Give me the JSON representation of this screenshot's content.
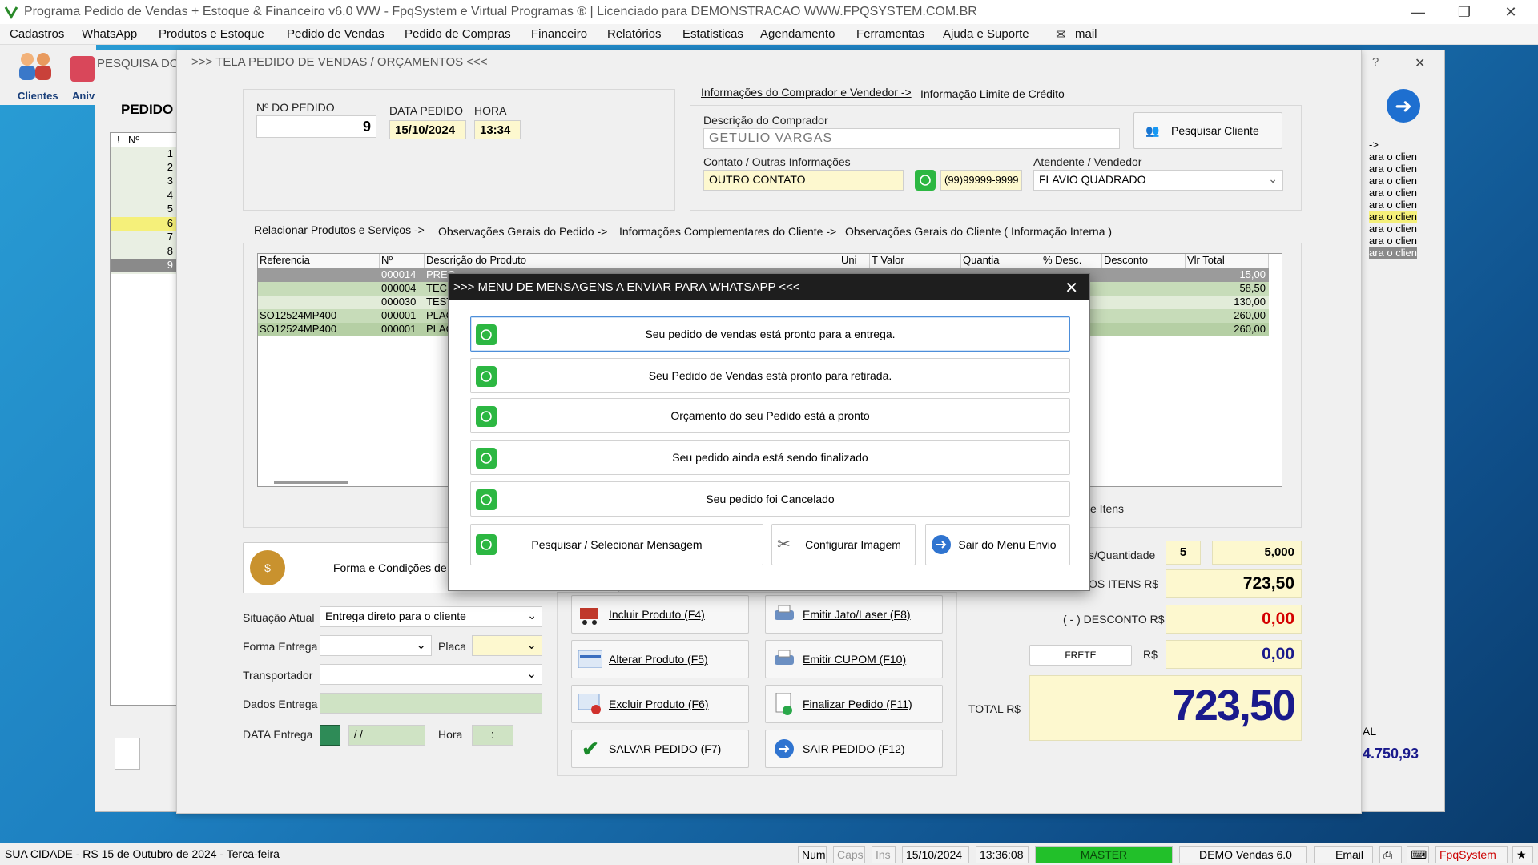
{
  "window": {
    "title": "Programa Pedido de Vendas + Estoque & Financeiro v6.0 WW - FpqSystem e Virtual Programas ® | Licenciado para  DEMONSTRACAO WWW.FPQSYSTEM.COM.BR",
    "minimize": "—",
    "maximize": "❐",
    "close": "✕"
  },
  "menu": [
    "Cadastros",
    "WhatsApp",
    "Produtos e Estoque",
    "Pedido de Vendas",
    "Pedido de Compras",
    "Financeiro",
    "Relatórios",
    "Estatisticas",
    "Agendamento",
    "Ferramentas",
    "Ajuda e Suporte",
    "mail"
  ],
  "toolbar": {
    "clientes": "Clientes",
    "aniv": "Aniv"
  },
  "bg_window": {
    "title": "PESQUISA DOS",
    "heading": "PEDIDO D",
    "list_header": [
      "!",
      "Nº"
    ],
    "list_rows": [
      "1",
      "2",
      "3",
      "4",
      "5",
      "6",
      "7",
      "8",
      "9"
    ],
    "right_items": [
      "->",
      "ara o clien",
      "ara o clien",
      "ara o clien",
      "ara o clien",
      "ara o clien",
      "ara o clien",
      "ara o clien",
      "ara o clien",
      "ara o clien"
    ],
    "total_label": "AL",
    "total_value": "4.750,93"
  },
  "main": {
    "title": ">>>  TELA PEDIDO DE VENDAS / ORÇAMENTOS  <<<",
    "help": "?",
    "close": "✕",
    "pedido_label": "Nº DO PEDIDO",
    "pedido_value": "9",
    "data_label": "DATA PEDIDO",
    "data_value": "15/10/2024",
    "hora_label": "HORA",
    "hora_value": "13:34",
    "tab_comprador": "Informações do Comprador e Vendedor ->",
    "tab_limite": "Informação Limite de Crédito",
    "comprador_label": "Descrição do Comprador",
    "comprador_value": "GETULIO VARGAS",
    "pesquisar_cliente": "Pesquisar Cliente",
    "contato_label": "Contato / Outras Informações",
    "contato_value": "OUTRO CONTATO",
    "telefone_value": "(99)99999-9999",
    "atendente_label": "Atendente / Vendedor",
    "atendente_value": "FLAVIO QUADRADO",
    "tabs": [
      "Relacionar Produtos e Serviços ->",
      "Observações Gerais do Pedido ->",
      "Informações Complementares do Cliente ->",
      "Observações Gerais do Cliente ( Informação Interna )"
    ],
    "grid_headers": [
      "Referencia",
      "Nº",
      "Descrição do Produto",
      "Uni",
      "T Valor",
      "Quantia",
      "% Desc.",
      "Desconto",
      "Vlr Total"
    ],
    "grid_rows": [
      {
        "ref": "",
        "num": "000014",
        "desc": "PREC",
        "total": "15,00"
      },
      {
        "ref": "",
        "num": "000004",
        "desc": "TECL",
        "total": "58,50"
      },
      {
        "ref": "",
        "num": "000030",
        "desc": "TEST",
        "total": "130,00"
      },
      {
        "ref": "SO12524MP400",
        "num": "000001",
        "desc": "PLAC",
        "total": "260,00"
      },
      {
        "ref": "SO12524MP400",
        "num": "000001",
        "desc": "PLAC",
        "total": "260,00"
      }
    ],
    "itens_label": "e Itens",
    "forma_pagamento": "Forma e Condições de Pa",
    "situacao_label": "Situação Atual",
    "situacao_value": "Entrega direto para o cliente",
    "forma_entrega_label": "Forma Entrega",
    "placa_label": "Placa",
    "transportador_label": "Transportador",
    "dados_entrega_label": "Dados Entrega",
    "data_entrega_label": "DATA Entrega",
    "data_entrega_value": " / /",
    "hora_entrega_label": "Hora",
    "hora_entrega_value": ":",
    "buttons": {
      "incluir": "Incluir Produto  (F4)",
      "alterar": "Alterar Produto  (F5)",
      "excluir": "Excluir Produto  (F6)",
      "salvar": "SALVAR PEDIDO  (F7)",
      "jato": "Emitir Jato/Laser (F8)",
      "cupom": "Emitir CUPOM  (F10)",
      "finalizar": "Finalizar Pedido  (F11)",
      "sair": "SAIR  PEDIDO  (F12)"
    },
    "qtd_label": "s/Quantidade",
    "qtd_itens": "5",
    "qtd_total": "5,000",
    "total_itens_label": "OS ITENS R$",
    "total_itens_value": "723,50",
    "desconto_label": "( - ) DESCONTO R$",
    "desconto_value": "0,00",
    "frete_label": "FRETE",
    "frete_rs": "R$",
    "frete_value": "0,00",
    "total_label": "TOTAL R$",
    "total_value": "723,50"
  },
  "modal": {
    "title": ">>> MENU DE MENSAGENS A ENVIAR PARA WHATSAPP <<<",
    "close": "✕",
    "messages": [
      "Seu pedido de vendas está pronto para a entrega.",
      "Seu Pedido de Vendas está pronto para retirada.",
      "Orçamento do seu Pedido está a pronto",
      "Seu pedido ainda está sendo finalizado",
      "Seu pedido foi Cancelado"
    ],
    "pesquisar": "Pesquisar / Selecionar Mensagem",
    "configurar": "Configurar Imagem",
    "sair": "Sair do Menu Envio"
  },
  "statusbar": {
    "location": "SUA CIDADE - RS 15 de Outubro de 2024 - Terca-feira",
    "num": "Num",
    "caps": "Caps",
    "ins": "Ins",
    "date": "15/10/2024",
    "time": "13:36:08",
    "user": "MASTER",
    "demo": "DEMO Vendas 6.0",
    "email": "Email",
    "brand": "FpqSystem"
  },
  "colors": {
    "accent": "#1e1e1e",
    "whatsapp": "#2cb742",
    "yellow_field": "#fdf8cf",
    "total_blue": "#1a1a8c",
    "red_value": "#d40000"
  }
}
